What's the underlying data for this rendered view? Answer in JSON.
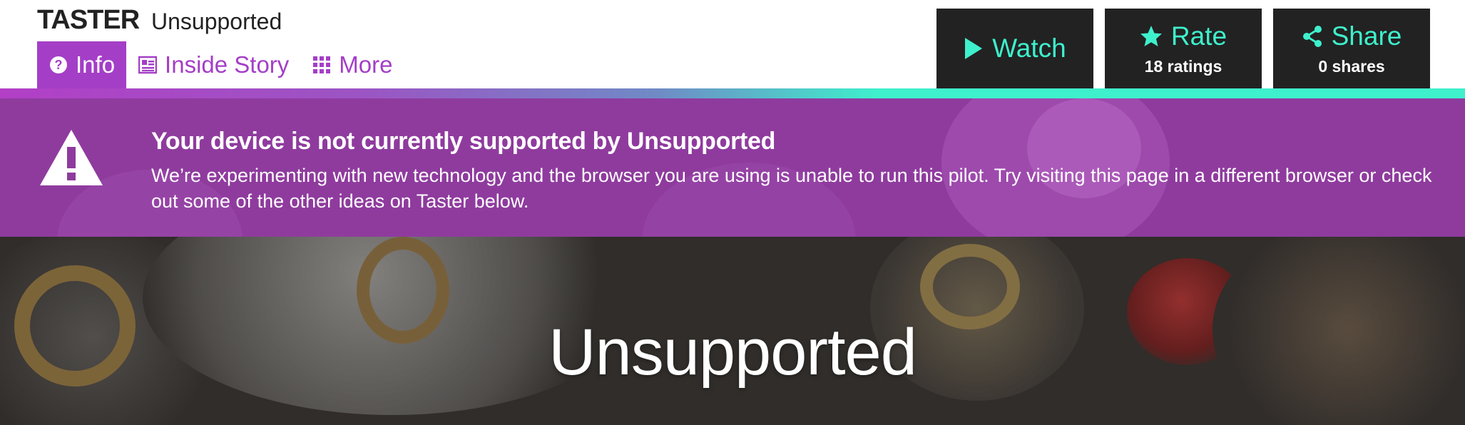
{
  "header": {
    "logo": "TASTER",
    "pilot_name": "Unsupported",
    "tabs": [
      {
        "label": "Info",
        "icon": "question-circle-icon",
        "active": true
      },
      {
        "label": "Inside Story",
        "icon": "article-icon",
        "active": false
      },
      {
        "label": "More",
        "icon": "grid-icon",
        "active": false
      }
    ],
    "actions": {
      "watch": {
        "label": "Watch",
        "icon": "play-icon"
      },
      "rate": {
        "label": "Rate",
        "sub": "18 ratings",
        "icon": "star-icon"
      },
      "share": {
        "label": "Share",
        "sub": "0 shares",
        "icon": "share-icon"
      }
    }
  },
  "banner": {
    "icon": "warning-triangle-icon",
    "title": "Your device is not currently supported by Unsupported",
    "text": "We’re experimenting with new technology and the browser you are using is unable to run this pilot. Try visiting this page in a different browser or check out some of the other ideas on Taster below."
  },
  "hero": {
    "title": "Unsupported"
  },
  "colors": {
    "accent_purple": "#a43ec7",
    "accent_teal": "#3ef0cc",
    "action_bg": "#222222",
    "banner_bg": "#8f3b9e"
  }
}
